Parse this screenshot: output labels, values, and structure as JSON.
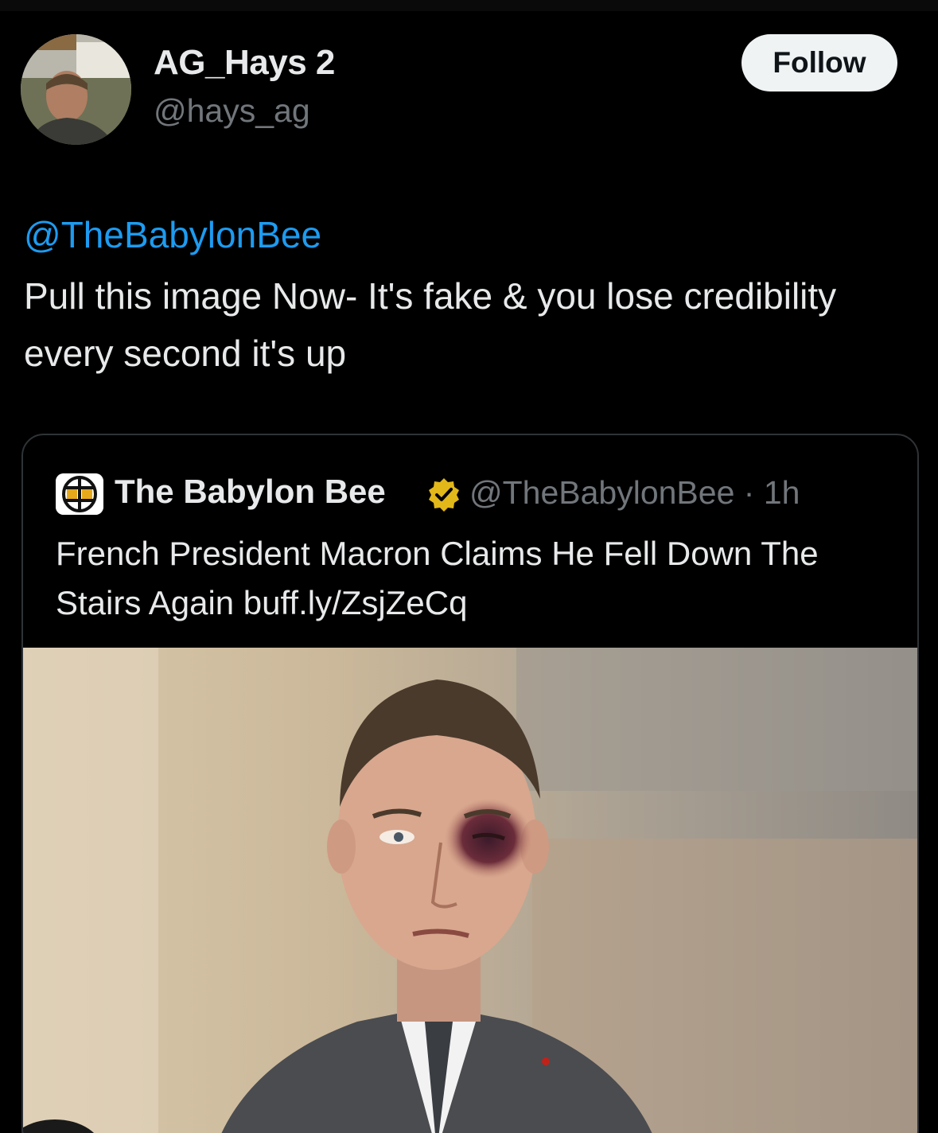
{
  "post": {
    "author": {
      "display_name": "AG_Hays 2",
      "handle": "@hays_ag"
    },
    "follow_label": "Follow",
    "mention": "@TheBabylonBee",
    "text": "Pull this image Now- It's fake & you lose credibility every second it's up"
  },
  "quote": {
    "author": {
      "display_name": "The Babylon Bee",
      "handle_time": "@TheBabylonBee · 1h"
    },
    "text": "French President Macron Claims He Fell Down The Stairs Again buff.ly/ZsjZeCq"
  },
  "colors": {
    "background": "#000000",
    "text_primary": "#e7e9ea",
    "text_secondary": "#71767b",
    "link": "#1d9bf0",
    "verified_badge": "#e2b719",
    "follow_button_bg": "#eff3f4"
  },
  "icons": {
    "verified": "verified-badge-icon",
    "logo": "babylon-bee-logo-icon"
  }
}
